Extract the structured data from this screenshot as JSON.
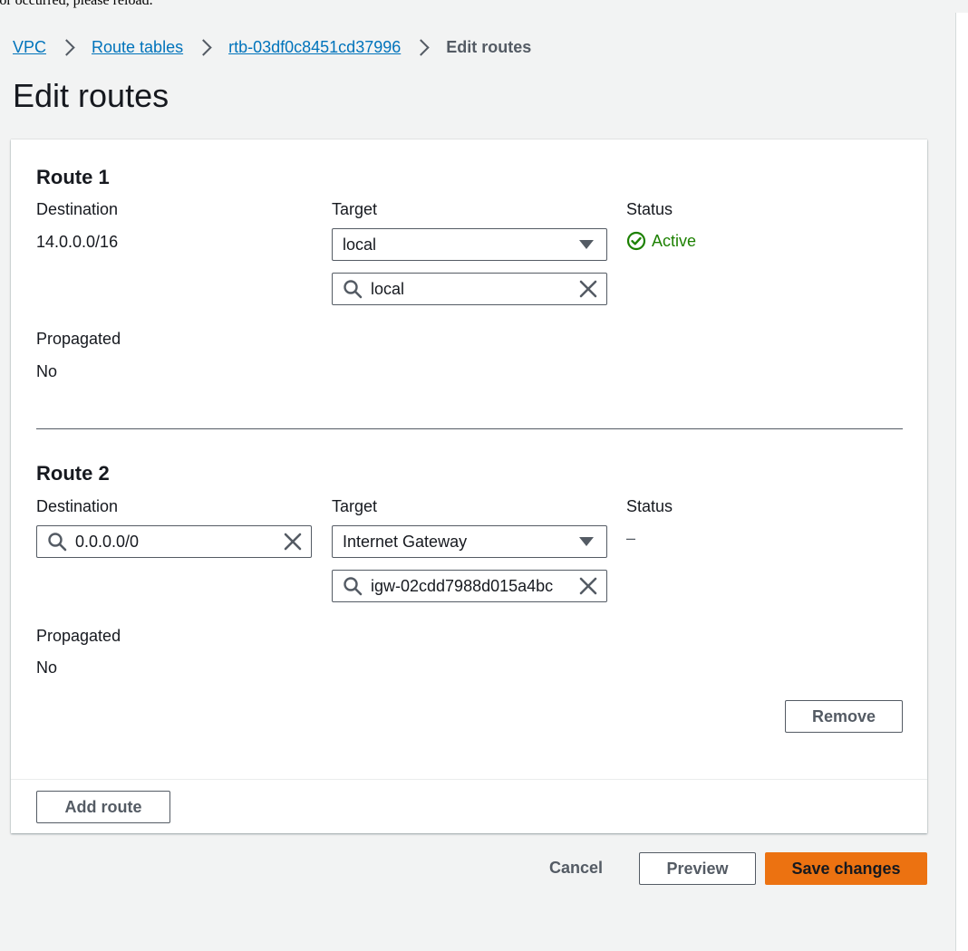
{
  "notice": {
    "text": "ror occurred, please reload."
  },
  "breadcrumb": {
    "items": [
      "VPC",
      "Route tables",
      "rtb-03df0c8451cd37996"
    ],
    "current": "Edit routes"
  },
  "page": {
    "title": "Edit routes"
  },
  "labels": {
    "destination": "Destination",
    "target": "Target",
    "status": "Status",
    "propagated": "Propagated"
  },
  "routes": [
    {
      "title": "Route 1",
      "destination": "14.0.0.0/16",
      "target_type": "local",
      "target_search": "local",
      "status": "Active",
      "propagated": "No"
    },
    {
      "title": "Route 2",
      "destination": "0.0.0.0/0",
      "target_type": "Internet Gateway",
      "target_search": "igw-02cdd7988d015a4bc",
      "status": "–",
      "propagated": "No",
      "remove_label": "Remove"
    }
  ],
  "panel": {
    "add_route_label": "Add route"
  },
  "actions": {
    "cancel_label": "Cancel",
    "preview_label": "Preview",
    "save_label": "Save changes"
  },
  "colors": {
    "link": "#0073bb",
    "status_active": "#1d8102",
    "primary_button": "#ec7211",
    "page_background": "#f2f3f3"
  },
  "icons": [
    "chevron-right-icon",
    "caret-down-icon",
    "search-icon",
    "close-icon",
    "check-circle-icon"
  ]
}
